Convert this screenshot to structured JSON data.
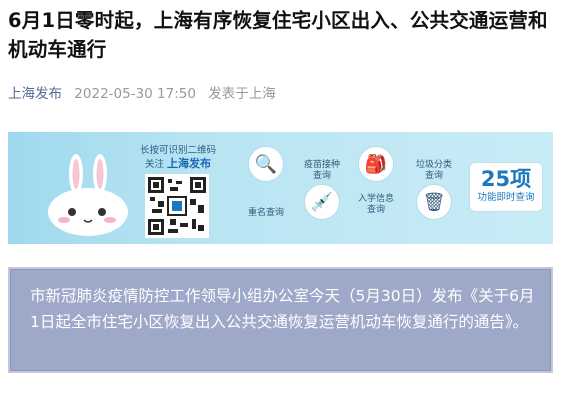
{
  "article": {
    "title": "6月1日零时起，上海有序恢复住宅小区出入、公共交通运营和机动车通行",
    "source": "上海发布",
    "datetime": "2022-05-30 17:50",
    "location": "发表于上海"
  },
  "banner": {
    "qr_hint": "长按可识别二维码",
    "follow_prefix": "关注",
    "follow_name": "上海发布",
    "features": [
      "重名查询",
      "疫苗接种查询",
      "入学信息查询",
      "垃圾分类查询"
    ],
    "count": "25项",
    "count_sub": "功能即时查询"
  },
  "quote": {
    "text": "市新冠肺炎疫情防控工作领导小组办公室今天（5月30日）发布《关于6月1日起全市住宅小区恢复出入公共交通恢复运营机动车恢复通行的通告》。"
  }
}
